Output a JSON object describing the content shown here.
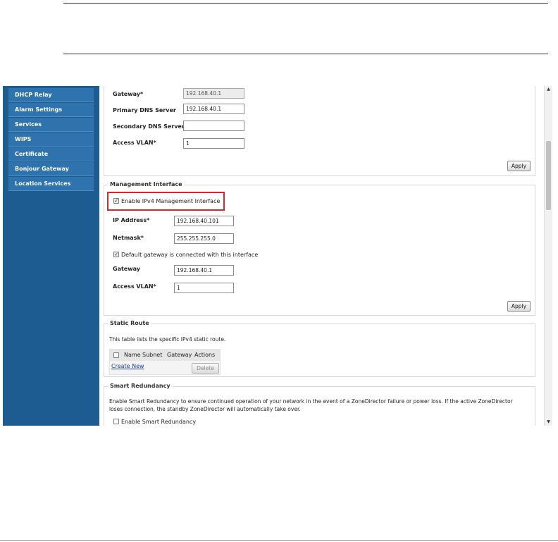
{
  "sidebar": {
    "items": [
      {
        "label": "DHCP Relay"
      },
      {
        "label": "Alarm Settings"
      },
      {
        "label": "Services"
      },
      {
        "label": "WIPS"
      },
      {
        "label": "Certificate"
      },
      {
        "label": "Bonjour Gateway"
      },
      {
        "label": "Location Services"
      }
    ]
  },
  "device_ip": {
    "gateway_label": "Gateway*",
    "gateway_value": "192.168.40.1",
    "primary_dns_label": "Primary DNS Server",
    "primary_dns_value": "192.168.40.1",
    "secondary_dns_label": "Secondary DNS Server",
    "secondary_dns_value": "",
    "access_vlan_label": "Access VLAN*",
    "access_vlan_value": "1",
    "apply_label": "Apply"
  },
  "management_interface": {
    "legend": "Management Interface",
    "enable_label": "Enable IPv4 Management Interface",
    "enable_checked": true,
    "ip_label": "IP Address*",
    "ip_value": "192.168.40.101",
    "netmask_label": "Netmask*",
    "netmask_value": "255.255.255.0",
    "default_gw_label": "Default gateway is connected with this interface",
    "default_gw_checked": true,
    "gateway_label": "Gateway",
    "gateway_value": "192.168.40.1",
    "access_vlan_label": "Access VLAN*",
    "access_vlan_value": "1",
    "apply_label": "Apply"
  },
  "static_route": {
    "legend": "Static Route",
    "description": "This table lists the specific IPv4 static route.",
    "columns": [
      "Name",
      "Subnet",
      "Gateway",
      "Actions"
    ],
    "create_new_label": "Create New",
    "delete_label": "Delete"
  },
  "smart_redundancy": {
    "legend": "Smart Redundancy",
    "description_line1": "Enable Smart Redundancy to ensure continued operation of your network in the event of a ZoneDirector failure or power loss. If the active ZoneDirector",
    "description_line2": "loses connection, the standby ZoneDirector will automatically take over.",
    "enable_label": "Enable Smart Redundancy",
    "enable_checked": false
  },
  "scrollbar": {
    "up_icon": "▲",
    "down_icon": "▼"
  },
  "colors": {
    "sidebar_bg": "#1c5c90",
    "nav_item_bg": "#2e73ad",
    "highlight": "#d9272e"
  }
}
